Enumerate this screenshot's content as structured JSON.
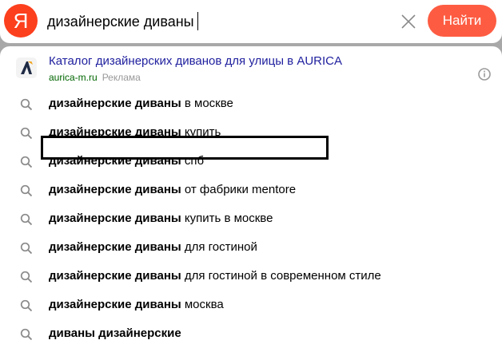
{
  "search": {
    "logo": "Я",
    "query": "дизайнерские диваны",
    "submit_label": "Найти",
    "clear_icon": "close-icon"
  },
  "ad": {
    "title": "Каталог дизайнерских диванов для улицы в AURICA",
    "domain": "aurica-m.ru",
    "label": "Реклама",
    "info_icon": "info-icon"
  },
  "suggestions": [
    {
      "bold": "дизайнерские диваны",
      "rest": " в москве"
    },
    {
      "bold": "дизайнерские диваны",
      "rest": " купить"
    },
    {
      "bold": "дизайнерские диваны",
      "rest": " спб"
    },
    {
      "bold": "дизайнерские диваны",
      "rest": " от фабрики mentore"
    },
    {
      "bold": "дизайнерские диваны",
      "rest": " купить в москве"
    },
    {
      "bold": "дизайнерские диваны",
      "rest": " для гостиной"
    },
    {
      "bold": "дизайнерские диваны",
      "rest": " для гостиной в современном стиле"
    },
    {
      "bold": "дизайнерские диваны",
      "rest": " москва"
    },
    {
      "bold": "диваны дизайнерские",
      "rest": ""
    }
  ],
  "highlighted_suggestion_index": 3,
  "colors": {
    "brand": "#fc3f1d",
    "button": "#fd5c42",
    "link": "#20209f",
    "domain": "#006600",
    "backdrop": "#a8a8a8"
  }
}
